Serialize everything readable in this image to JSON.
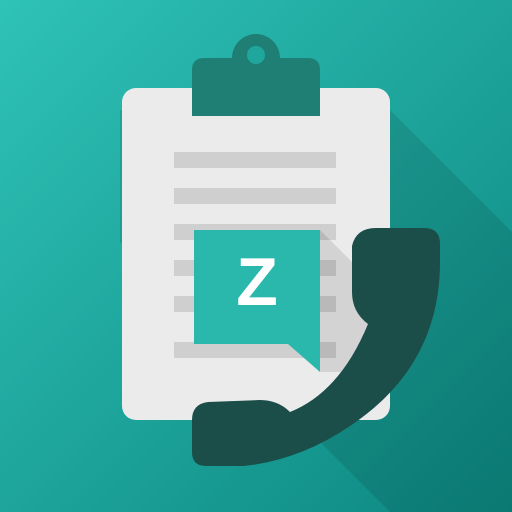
{
  "app_icon": {
    "badge_letter": "Z",
    "icons": [
      "clipboard-icon",
      "chat-bubble-icon",
      "phone-handset-icon"
    ],
    "colors": {
      "background_light": "#2dbfb4",
      "background_dark": "#0e8a83",
      "clipboard_body": "#ebebeb",
      "clipboard_clip": "#207f74",
      "text_lines": "#cfcfcf",
      "bubble": "#2ab8ad",
      "handset": "#1b4d49",
      "badge_text": "#ffffff"
    }
  }
}
